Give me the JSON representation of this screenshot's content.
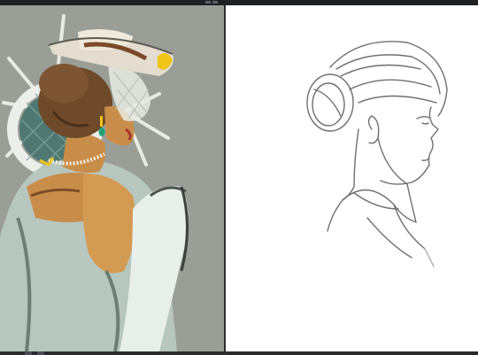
{
  "app": {
    "panels": [
      {
        "name": "painted-canvas",
        "subject": "color-painting"
      },
      {
        "name": "sketch-canvas",
        "subject": "pencil-sketch"
      }
    ]
  },
  "colors": {
    "ui_dark": "#1f2023",
    "canvas_bg": "#9a9e96",
    "dress": "#b8c7c0",
    "skin": "#c98d4a",
    "hair": "#6e4a2b",
    "hat": "#e3dccf",
    "gold": "#f0c419",
    "sketch_line": "#6f6f6f"
  },
  "icons": {
    "topbar_marker": "toolbar-indicator-icon"
  }
}
